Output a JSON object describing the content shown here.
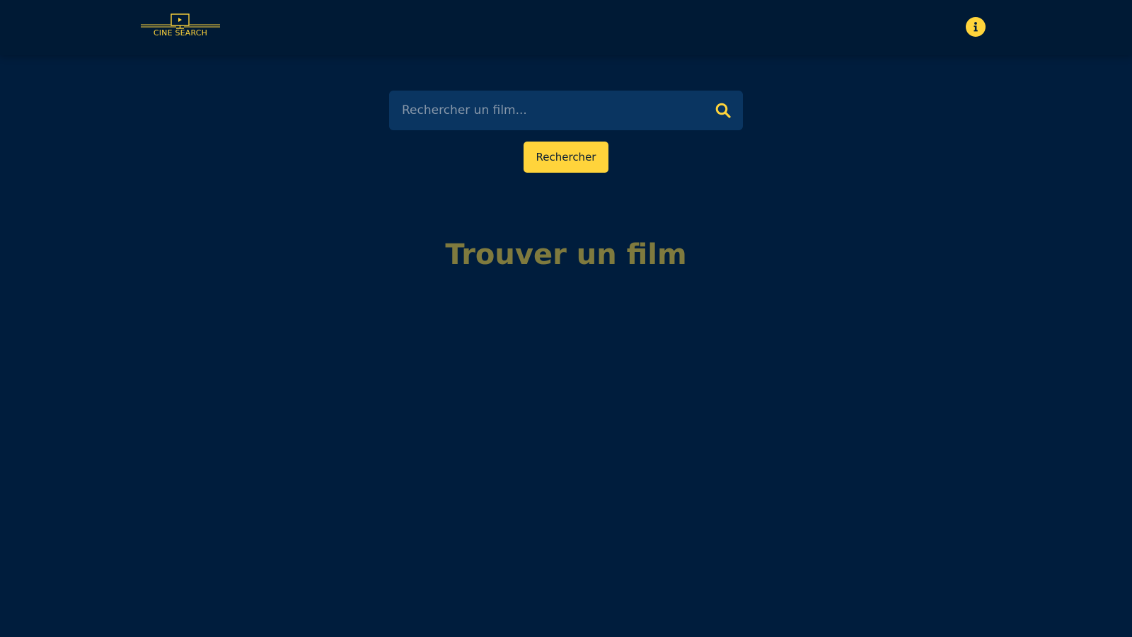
{
  "header": {
    "logo_text": "CINE SEARCH",
    "logo_icon": "monitor-play-icon",
    "info_icon": "info-icon"
  },
  "search": {
    "placeholder": "Rechercher un film...",
    "value": "",
    "icon": "search-icon",
    "button_label": "Rechercher"
  },
  "main": {
    "title": "Trouver un film"
  },
  "colors": {
    "background": "#001d3d",
    "header": "#001a35",
    "accent": "#ffd43b",
    "search_field": "#0a3561",
    "title": "#7f7a3e"
  }
}
